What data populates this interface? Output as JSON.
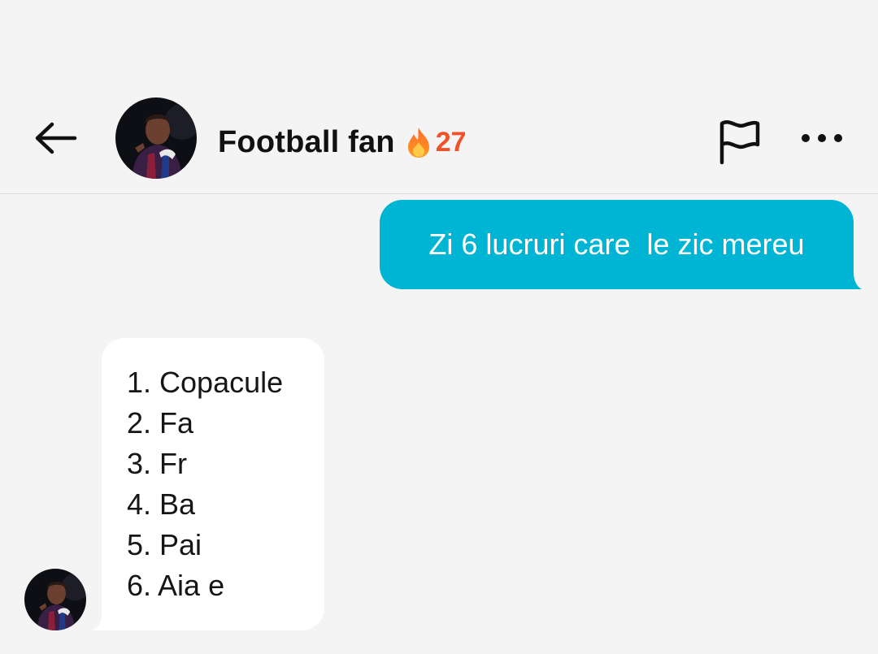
{
  "header": {
    "contact_name": "Football fan",
    "streak_count": "27",
    "icons": {
      "back": "arrow-left-icon",
      "streak": "flame-icon",
      "report": "flag-icon",
      "more": "more-horizontal-icon"
    }
  },
  "messages": {
    "sent": {
      "text": "Zi 6 lucruri care  le zic mereu"
    },
    "received": {
      "lines": [
        "1. Copacule",
        "2. Fa",
        "3. Fr",
        "4. Ba",
        "5. Pai",
        "6. Aia e"
      ]
    }
  },
  "colors": {
    "background": "#f4f4f4",
    "sent_bubble": "#00b4d4",
    "received_bubble": "#ffffff",
    "streak": "#f0522a",
    "text": "#111111"
  }
}
